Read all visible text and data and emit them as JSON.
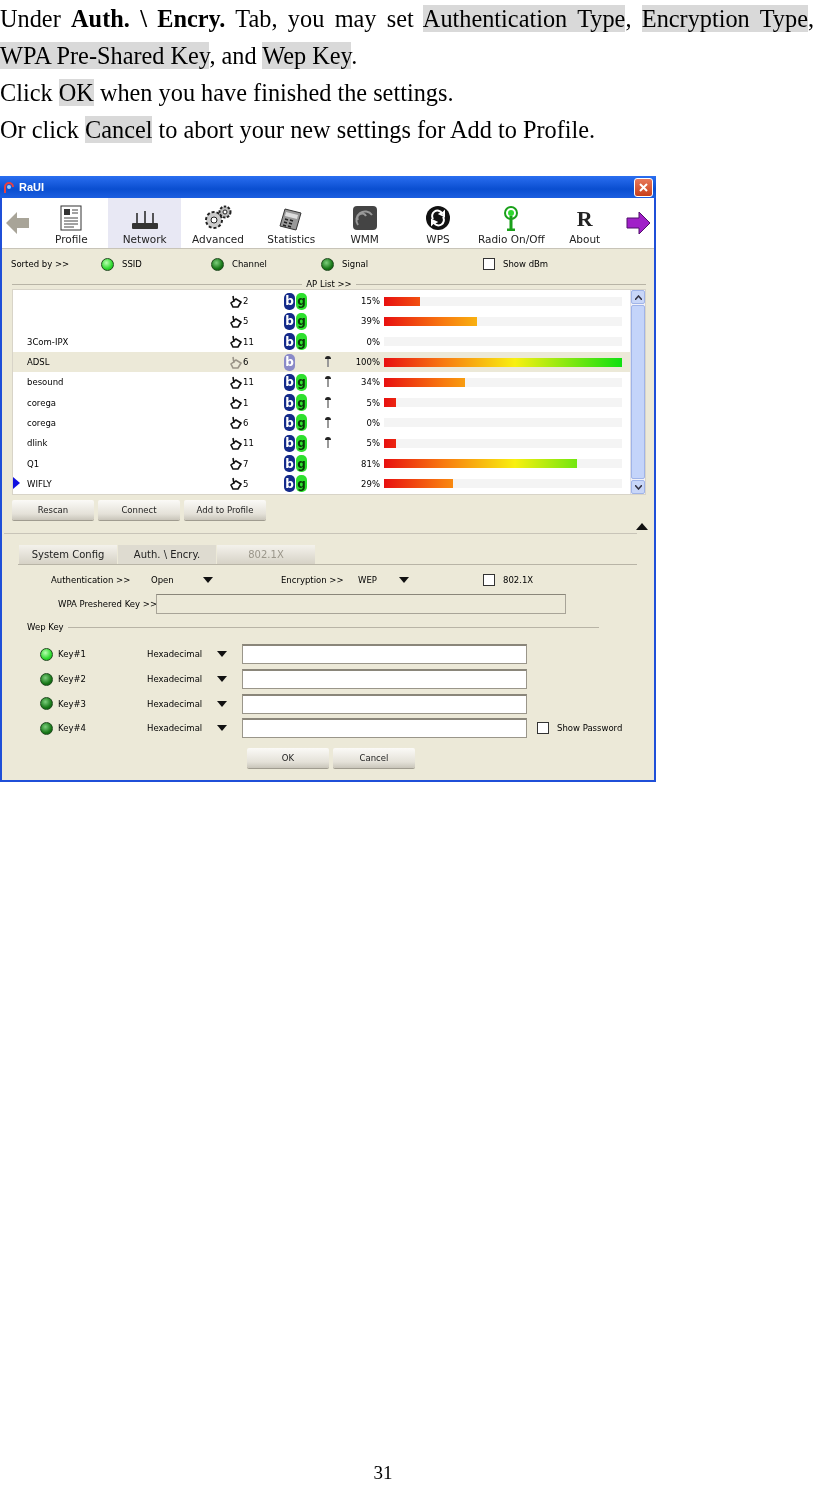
{
  "paragraphs": [
    {
      "segments": [
        {
          "text": "Under **Auth. \\ Encry.** Tab, you may set ",
          "highlighted": false
        },
        {
          "text": "Authentication Type",
          "highlighted": true
        },
        {
          "text": ", ",
          "highlighted": false
        },
        {
          "text": "Encryption Type",
          "highlighted": true
        },
        {
          "text": ", ",
          "highlighted": false
        },
        {
          "text": "WPA Pre-Shared Key",
          "highlighted": true
        },
        {
          "text": ", and ",
          "highlighted": false
        },
        {
          "text": "Wep Key",
          "highlighted": true
        },
        {
          "text": ".",
          "highlighted": false
        }
      ]
    },
    {
      "segments": [
        {
          "text": "Click ",
          "highlighted": false
        },
        {
          "text": "OK",
          "highlighted": true
        },
        {
          "text": " when you have finished the settings.",
          "highlighted": false
        }
      ]
    },
    {
      "segments": [
        {
          "text": "Or click ",
          "highlighted": false
        },
        {
          "text": "Cancel",
          "highlighted": true
        },
        {
          "text": " to abort your new settings for Add to Profile.",
          "highlighted": false
        }
      ]
    }
  ],
  "window": {
    "title": "RaUI",
    "toolbar": [
      {
        "kind": "profile",
        "label": "Profile",
        "selected": false
      },
      {
        "kind": "network",
        "label": "Network",
        "selected": true
      },
      {
        "kind": "advanced",
        "label": "Advanced",
        "selected": false
      },
      {
        "kind": "statistics",
        "label": "Statistics",
        "selected": false
      },
      {
        "kind": "wmm",
        "label": "WMM",
        "selected": false
      },
      {
        "kind": "wps",
        "label": "WPS",
        "selected": false
      },
      {
        "kind": "radio",
        "label": "Radio On/Off",
        "selected": false
      },
      {
        "kind": "about",
        "label": "About",
        "glyph": "R",
        "selected": false
      }
    ],
    "sort": {
      "label": "Sorted by >>",
      "options": [
        {
          "label": "SSID",
          "selected": true
        },
        {
          "label": "Channel",
          "selected": false
        },
        {
          "label": "Signal",
          "selected": false
        }
      ]
    },
    "show_dbm": {
      "label": "Show dBm",
      "checked": false
    },
    "ap_list": {
      "title": "AP List >>",
      "rows": [
        {
          "channel": "2",
          "modes": [
            "b",
            "g"
          ],
          "secured": false,
          "signal": "15%",
          "level": 0.15,
          "selected": false,
          "connected": false
        },
        {
          "channel": "5",
          "modes": [
            "b",
            "g"
          ],
          "secured": false,
          "signal": "39%",
          "level": 0.39,
          "selected": false,
          "connected": false
        },
        {
          "ssid": "3Com-IPX",
          "channel": "11",
          "modes": [
            "b",
            "g"
          ],
          "secured": false,
          "signal": "0%",
          "selected": false,
          "connected": false
        },
        {
          "ssid": "ADSL",
          "channel": "6",
          "modes": [
            "b"
          ],
          "secured": true,
          "signal": "100%",
          "level": 1,
          "selected": true,
          "connected": false
        },
        {
          "ssid": "besound",
          "channel": "11",
          "modes": [
            "b",
            "g"
          ],
          "secured": true,
          "signal": "34%",
          "level": 0.34,
          "selected": false,
          "connected": false
        },
        {
          "ssid": "corega",
          "channel": "1",
          "modes": [
            "b",
            "g"
          ],
          "secured": true,
          "signal": "5%",
          "level": 0.05,
          "selected": false,
          "connected": false
        },
        {
          "ssid": "corega",
          "channel": "6",
          "modes": [
            "b",
            "g"
          ],
          "secured": true,
          "signal": "0%",
          "selected": false,
          "connected": false
        },
        {
          "ssid": "dlink",
          "channel": "11",
          "modes": [
            "b",
            "g"
          ],
          "secured": true,
          "signal": "5%",
          "level": 0.05,
          "selected": false,
          "connected": false
        },
        {
          "ssid": "Q1",
          "channel": "7",
          "modes": [
            "b",
            "g"
          ],
          "secured": false,
          "signal": "81%",
          "level": 0.81,
          "selected": false,
          "connected": false
        },
        {
          "ssid": "WIFLY",
          "channel": "5",
          "modes": [
            "b",
            "g"
          ],
          "secured": false,
          "signal": "29%",
          "level": 0.29,
          "selected": false,
          "connected": true
        }
      ]
    },
    "list_buttons": [
      "Rescan",
      "Connect",
      "Add to Profile"
    ],
    "tabs": [
      {
        "label": "System Config",
        "selected": false,
        "disabled": false
      },
      {
        "label": "Auth. \\ Encry.",
        "selected": true,
        "disabled": false
      },
      {
        "label": "802.1X",
        "selected": false,
        "disabled": true
      }
    ],
    "authentication": {
      "label": "Authentication >>",
      "value": "Open"
    },
    "encryption": {
      "label": "Encryption >>",
      "value": "WEP"
    },
    "dot1x": {
      "label": "802.1X",
      "checked": false
    },
    "wpa_key": {
      "label": "WPA Preshered Key >>",
      "disabled": true
    },
    "wep_key": {
      "title": "Wep Key",
      "keys": [
        {
          "label": "Key#1",
          "format": "Hexadecimal",
          "selected": true
        },
        {
          "label": "Key#2",
          "format": "Hexadecimal",
          "selected": false
        },
        {
          "label": "Key#3",
          "format": "Hexadecimal",
          "selected": false
        },
        {
          "label": "Key#4",
          "format": "Hexadecimal",
          "selected": false
        }
      ]
    },
    "show_password": {
      "label": "Show Password",
      "checked": false
    },
    "buttons": [
      "OK",
      "Cancel"
    ]
  },
  "page_number": "31"
}
